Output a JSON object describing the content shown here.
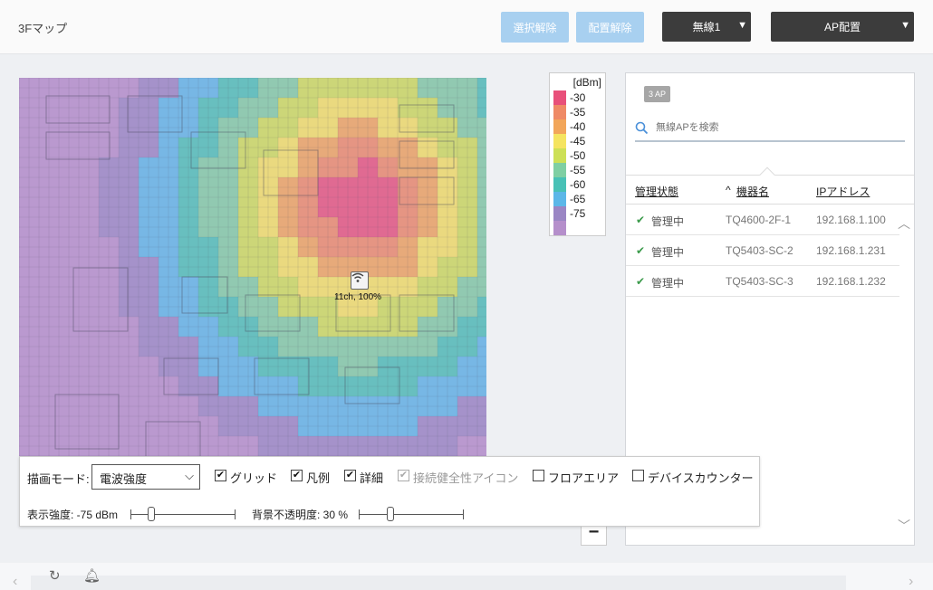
{
  "header": {
    "title": "3Fマップ",
    "deselect_label": "選択解除",
    "unplace_label": "配置解除",
    "wireless_select": "無線1",
    "ap_place_select": "AP配置"
  },
  "map": {
    "ap_label": "11ch, 100%",
    "icon": "wifi-icon"
  },
  "legend": {
    "unit": "[dBm]",
    "items": [
      {
        "value": "-30",
        "color": "#e8507a"
      },
      {
        "value": "-35",
        "color": "#ef8a66"
      },
      {
        "value": "-40",
        "color": "#f2a65a"
      },
      {
        "value": "-45",
        "color": "#f5e460"
      },
      {
        "value": "-50",
        "color": "#cde057"
      },
      {
        "value": "-55",
        "color": "#7fcfa3"
      },
      {
        "value": "-60",
        "color": "#48c1b6"
      },
      {
        "value": "-65",
        "color": "#5cb7e8"
      },
      {
        "value": "-75",
        "color": "#9a86c4"
      },
      {
        "value": "",
        "color": "#b58fcb"
      }
    ]
  },
  "panel": {
    "ap_count": "3 AP",
    "search_placeholder": "無線APを検索",
    "columns": {
      "status": "管理状態",
      "device": "機器名",
      "ip": "IPアドレス",
      "sort_indicator": "^"
    },
    "rows": [
      {
        "status": "管理中",
        "device": "TQ4600-2F-1",
        "ip": "192.168.1.100"
      },
      {
        "status": "管理中",
        "device": "TQ5403-SC-2",
        "ip": "192.168.1.231"
      },
      {
        "status": "管理中",
        "device": "TQ5403-SC-3",
        "ip": "192.168.1.232"
      }
    ]
  },
  "controls": {
    "draw_mode_label": "描画モード:",
    "draw_mode_value": "電波強度",
    "checkboxes": [
      {
        "label": "グリッド",
        "checked": true,
        "disabled": false
      },
      {
        "label": "凡例",
        "checked": true,
        "disabled": false
      },
      {
        "label": "詳細",
        "checked": true,
        "disabled": false
      },
      {
        "label": "接続健全性アイコン",
        "checked": true,
        "disabled": true
      },
      {
        "label": "フロアエリア",
        "checked": false,
        "disabled": false
      },
      {
        "label": "デバイスカウンター",
        "checked": false,
        "disabled": false
      }
    ],
    "strength_label": "表示強度: -75 dBm",
    "opacity_label": "背景不透明度: 30 %",
    "strength_slider": 0.2,
    "opacity_slider": 0.3
  },
  "zoom_out": "−"
}
